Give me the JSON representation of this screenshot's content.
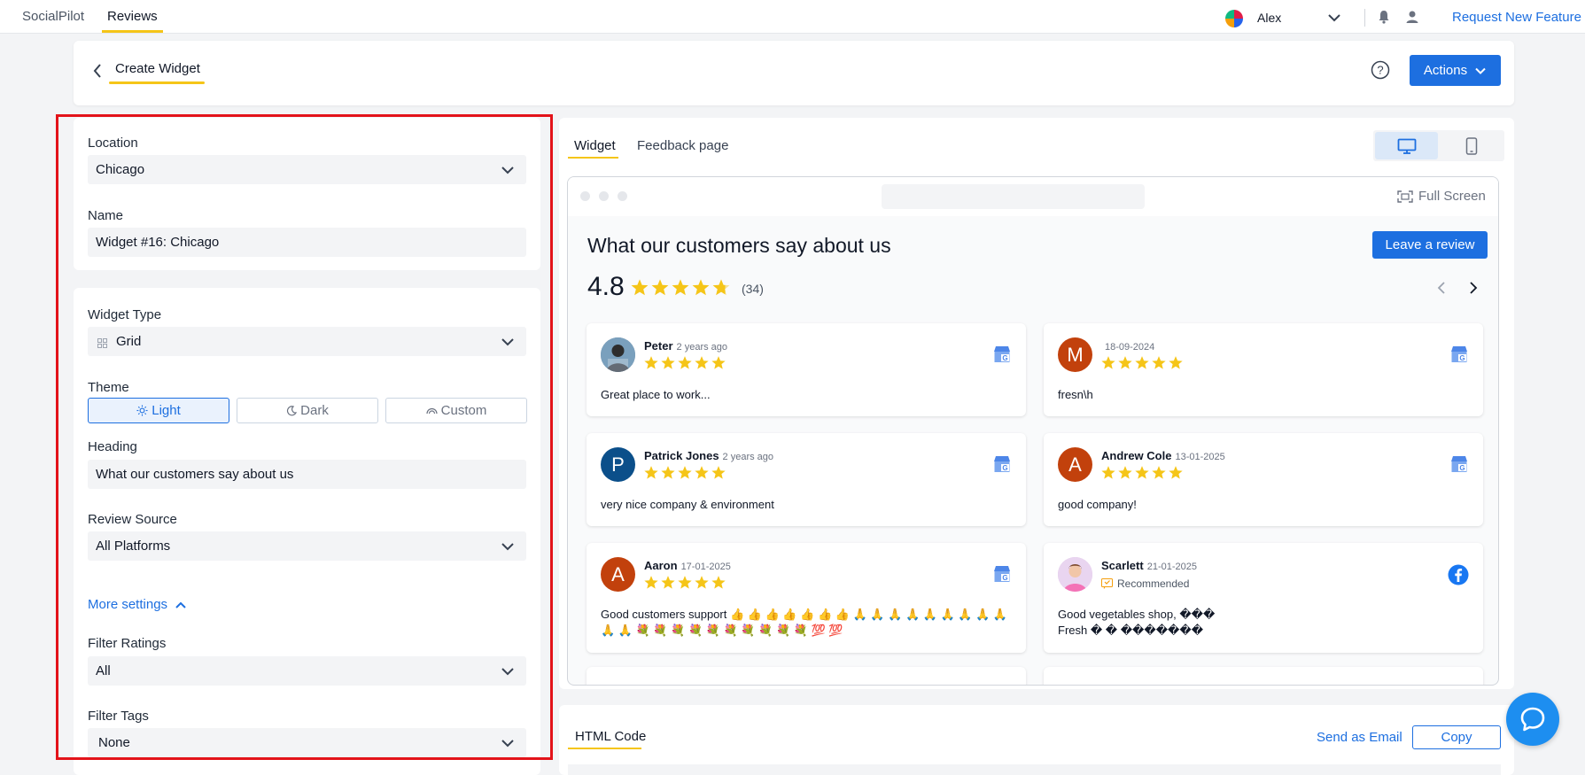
{
  "topnav": {
    "tabs": [
      "SocialPilot",
      "Reviews"
    ],
    "user_name": "Alex",
    "request_feature": "Request New Feature"
  },
  "header": {
    "title": "Create Widget",
    "actions_label": "Actions"
  },
  "form": {
    "location": {
      "label": "Location",
      "value": "Chicago"
    },
    "name": {
      "label": "Name",
      "value": "Widget #16: Chicago"
    },
    "widget_type": {
      "label": "Widget Type",
      "value": "Grid"
    },
    "theme": {
      "label": "Theme",
      "options": [
        "Light",
        "Dark",
        "Custom"
      ],
      "selected": "Light"
    },
    "heading": {
      "label": "Heading",
      "value": "What our customers say about us"
    },
    "review_source": {
      "label": "Review Source",
      "value": "All Platforms"
    },
    "more_settings": "More settings",
    "filter_ratings": {
      "label": "Filter Ratings",
      "value": "All"
    },
    "filter_tags": {
      "label": "Filter Tags",
      "value": "None"
    }
  },
  "preview": {
    "tabs": [
      "Widget",
      "Feedback page"
    ],
    "full_screen": "Full Screen",
    "heading": "What our customers say about us",
    "leave_review": "Leave a review",
    "rating": "4.8",
    "rating_count": "(34)",
    "reviews": [
      {
        "name": "Peter",
        "date": "2 years ago",
        "text": "Great place to work...",
        "initial": "",
        "source": "google-business-icon",
        "stars": 5
      },
      {
        "name": "",
        "date": "18-09-2024",
        "text": "fresn\\h",
        "initial": "M",
        "source": "google-business-icon",
        "stars": 5
      },
      {
        "name": "Patrick Jones",
        "date": "2 years ago",
        "text": "very nice company & environment",
        "initial": "P",
        "source": "google-business-icon",
        "stars": 5
      },
      {
        "name": "Andrew Cole",
        "date": "13-01-2025",
        "text": "good company!",
        "initial": "A",
        "source": "google-business-icon",
        "stars": 5
      },
      {
        "name": "Aaron",
        "date": "17-01-2025",
        "text": "Good customers support 👍 👍 👍 👍 👍 👍 👍 🙏 🙏 🙏 🙏 🙏 🙏 🙏 🙏 🙏 🙏 🙏 💐 💐 💐 💐 💐 💐 💐 💐 💐 💐 💯 💯",
        "initial": "A",
        "source": "google-business-icon",
        "stars": 5
      },
      {
        "name": "Scarlett",
        "date": "21-01-2025",
        "text": "Good vegetables shop, ���\nFresh � � �������",
        "initial": "",
        "source": "facebook-icon",
        "recommended": "Recommended"
      }
    ]
  },
  "html_code": {
    "title": "HTML Code",
    "send_email": "Send as Email",
    "copy": "Copy"
  },
  "colors": {
    "accent": "#1d6fe0",
    "tab_underline": "#f5c518",
    "star": "#f5c518",
    "highlight_border": "#e3131a",
    "avatar_red": "#c2410c",
    "avatar_blue": "#0b4f8a"
  }
}
